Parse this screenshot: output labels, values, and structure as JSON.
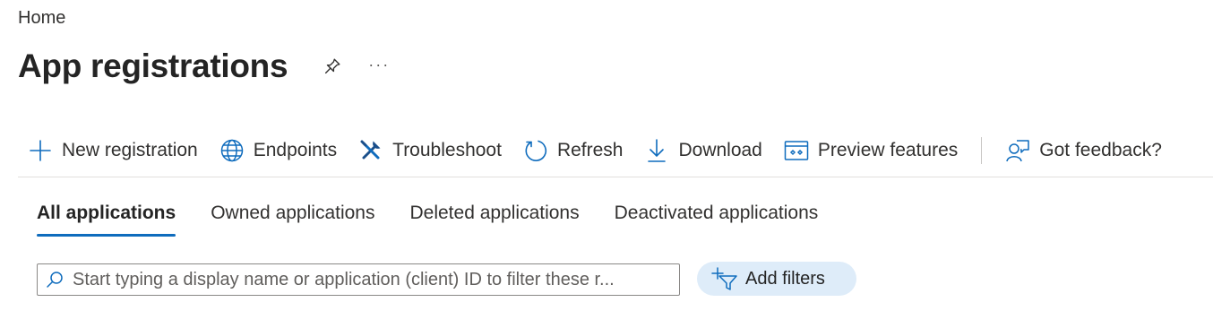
{
  "breadcrumb": {
    "home_label": "Home"
  },
  "header": {
    "title": "App registrations",
    "more_label": "···"
  },
  "toolbar": {
    "items": [
      {
        "label": "New registration",
        "icon": "plus-icon"
      },
      {
        "label": "Endpoints",
        "icon": "globe-icon"
      },
      {
        "label": "Troubleshoot",
        "icon": "wrench-icon"
      },
      {
        "label": "Refresh",
        "icon": "refresh-icon"
      },
      {
        "label": "Download",
        "icon": "download-icon"
      },
      {
        "label": "Preview features",
        "icon": "preview-icon"
      }
    ],
    "feedback": {
      "label": "Got feedback?",
      "icon": "feedback-icon"
    }
  },
  "tabs": [
    {
      "label": "All applications",
      "active": true
    },
    {
      "label": "Owned applications",
      "active": false
    },
    {
      "label": "Deleted applications",
      "active": false
    },
    {
      "label": "Deactivated applications",
      "active": false
    }
  ],
  "search": {
    "placeholder": "Start typing a display name or application (client) ID to filter these r...",
    "value": ""
  },
  "filters": {
    "add_label": "Add filters"
  },
  "colors": {
    "accent": "#0f6cbd",
    "filter_bg": "#deecf9"
  }
}
